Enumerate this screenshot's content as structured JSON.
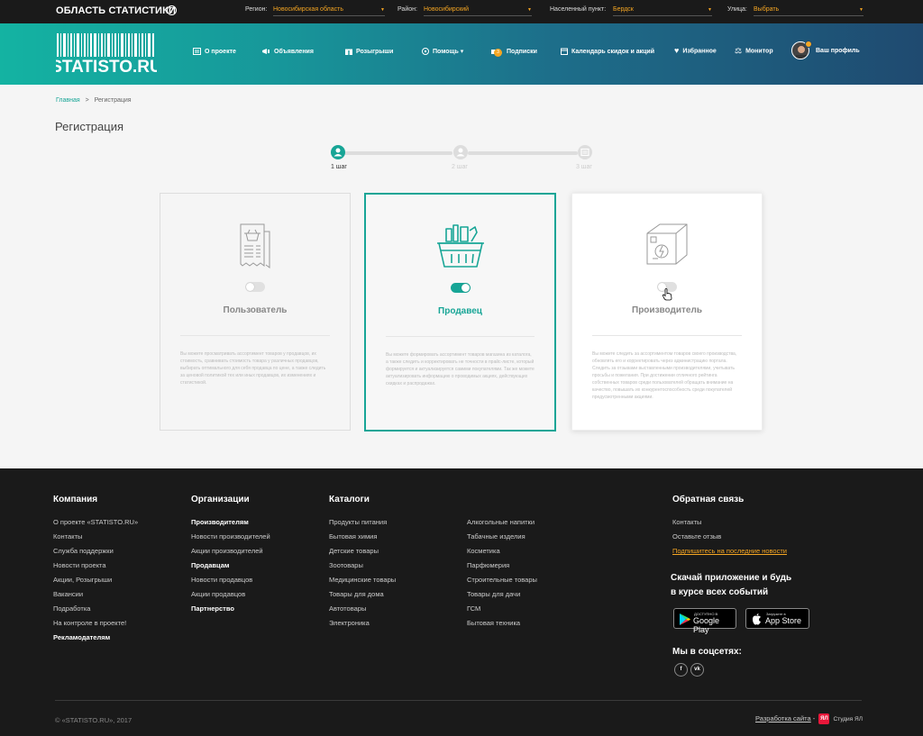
{
  "topbar": {
    "brand": "ОБЛАСТЬ СТАТИСТИКИ",
    "help_glyph": "?",
    "filters": [
      {
        "label": "Регион:",
        "value": "Новосибирская область"
      },
      {
        "label": "Район:",
        "value": "Новосибирский"
      },
      {
        "label": "Населенный пункт:",
        "value": "Бердск"
      },
      {
        "label": "Улица:",
        "value": "Выбрать"
      }
    ]
  },
  "header": {
    "logo_text": "STATISTO.RU",
    "nav": [
      {
        "label": "О проекте",
        "icon": "about-icon"
      },
      {
        "label": "Объявления",
        "icon": "ads-icon"
      },
      {
        "label": "Розыгрыши",
        "icon": "gift-icon"
      },
      {
        "label": "Помощь",
        "icon": "help-icon"
      },
      {
        "label": "Подписки",
        "icon": "subscriptions-icon"
      },
      {
        "label": "Календарь скидок и акций",
        "icon": "calendar-icon"
      },
      {
        "label": "Избранное",
        "icon": "heart-icon"
      },
      {
        "label": "Монитор",
        "icon": "scales-icon"
      },
      {
        "label": "Ваш профиль",
        "icon": "avatar"
      }
    ],
    "help_caret": "▾",
    "subscriptions_badge": "3"
  },
  "breadcrumb": {
    "home": "Главная",
    "separator": ">",
    "current": "Регистрация"
  },
  "page_title": "Регистрация",
  "steps": [
    {
      "label": "1 шаг",
      "active": true
    },
    {
      "label": "2 шаг",
      "active": false
    },
    {
      "label": "3 шаг",
      "active": false
    }
  ],
  "cards": [
    {
      "title": "Пользователь",
      "toggle_on": false,
      "description": "Вы можете просматривать ассортимент товаров у продавцов, их стоимость, сравнивать стоимость товара у различных продавцов, выбирать оптимального для себя продавца по цене, а также следить за ценовой политикой тех или иных продавцов, их изменениях и статистикой."
    },
    {
      "title": "Продавец",
      "toggle_on": true,
      "description": "Вы можете формировать ассортимент товаров магазина из каталога, а также следить и корректировать не точности в прайс-листе, который формируется и актуализируется самими покупателями. Так же можете актуализировать информацию о проводимых акциях, действующих скидках и распродажах."
    },
    {
      "title": "Производитель",
      "toggle_on": false,
      "description": "Вы можете следить за ассортиментом товаров своего производства, обновлять его и корректировать через администрацию портала. Следить за отзывами выставленными производителями, учитывать просьбы и пожелания. При достижении отличного рейтинга собственных товаров среди пользователей обращать внимание на качество, повышать их конкурентоспособность среди покупателей предусмотренными акциями."
    }
  ],
  "footer": {
    "company": {
      "title": "Компания",
      "links": [
        "О проекте «STATISTO.RU»",
        "Контакты",
        "Служба поддержки",
        "Новости проекта",
        "Акции, Розыгрыши",
        "Вакансии",
        "Подработка",
        "На контроле в проекте!",
        "Рекламодателям"
      ]
    },
    "organizations": {
      "title": "Организации",
      "links": [
        "Производителям",
        "Новости производителей",
        "Акции производителей",
        "Продавцам",
        "Новости продавцов",
        "Акции продавцов",
        "Партнерство"
      ]
    },
    "catalogs": {
      "title": "Каталоги",
      "col1": [
        "Продукты питания",
        "Бытовая химия",
        "Детские товары",
        "Зоотовары",
        "Медицинские товары",
        "Товары для дома",
        "Автотовары",
        "Электроника"
      ],
      "col2": [
        "Алкогольные напитки",
        "Табачные изделия",
        "Косметика",
        "Парфюмерия",
        "Строительные товары",
        "Товары для дачи",
        "ГСМ",
        "Бытовая техника"
      ]
    },
    "feedback": {
      "title": "Обратная связь",
      "links": [
        "Контакты",
        "Оставьте отзыв"
      ],
      "subscribe": "Подпишитесь на последние новости"
    },
    "app_title_1": "Скачай приложение и будь",
    "app_title_2": "в курсе всех событий",
    "google_small": "ДОСТУПНО В",
    "google_big": "Google Play",
    "apple_small": "Загрузите в",
    "apple_big": "App Store",
    "social_title": "Мы в соцсетях:",
    "social_fb": "f",
    "social_vk": "vk",
    "copyright": "© «STATISTO.RU», 2017",
    "dev_link": "Разработка сайта",
    "dev_dash": "-",
    "dev_logo": "ЯЛ",
    "dev_studio": "Студия ЯЛ"
  },
  "colors": {
    "accent": "#17a596",
    "orange": "#f5a623",
    "footer_bg": "#1a1a1a"
  }
}
